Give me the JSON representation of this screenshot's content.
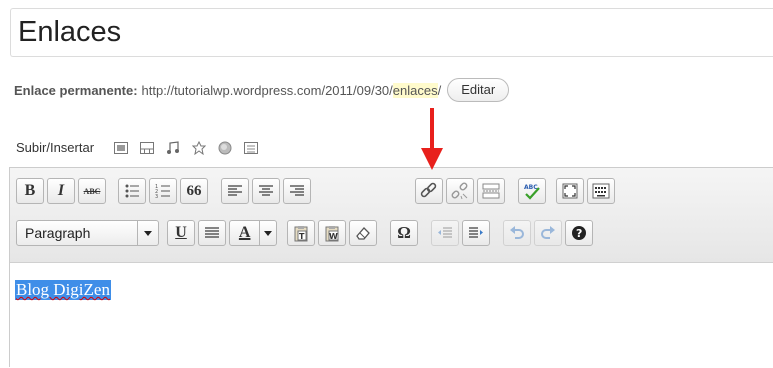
{
  "post": {
    "title": "Enlaces"
  },
  "permalink": {
    "label": "Enlace permanente:",
    "url_base": "http://tutorialwp.wordpress.com/2011/09/30/",
    "slug": "enlaces",
    "trailing": "/",
    "edit_button": "Editar"
  },
  "media": {
    "label": "Subir/Insertar",
    "icons": [
      "image-icon",
      "video-icon",
      "audio-icon",
      "media-icon",
      "poll-icon",
      "form-icon"
    ]
  },
  "toolbar": {
    "row1": {
      "bold": "B",
      "italic": "I",
      "strikethrough": "ABC",
      "quote": "66",
      "spellcheck": "ABC"
    },
    "row2": {
      "format_select": "Paragraph",
      "underline": "U",
      "text_color": "A",
      "omega": "Ω"
    }
  },
  "editor": {
    "content": "Blog DigiZen"
  },
  "colors": {
    "arrow": "#e8201c",
    "selection": "#3f8ee8",
    "slug_highlight": "#fffbcc"
  }
}
